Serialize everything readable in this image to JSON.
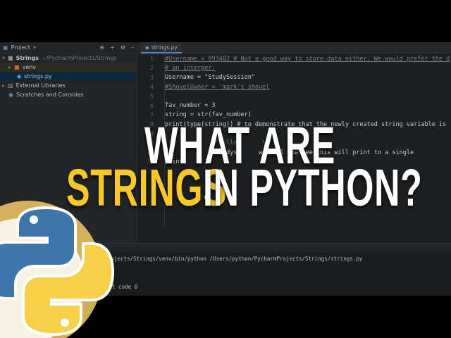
{
  "sidebar": {
    "title": "Project",
    "items": [
      {
        "label": "Strings",
        "extra": "~/PycharmProjects/Strings"
      },
      {
        "label": "venv"
      },
      {
        "label": "strings.py"
      },
      {
        "label": "External Libraries"
      },
      {
        "label": "Scratches and Consoles"
      }
    ]
  },
  "tab": {
    "label": "strings.py"
  },
  "code": [
    {
      "n": "1",
      "text": "#Username = 093482 # Not a good way to store data either. We would prefer the d",
      "cls": "cm"
    },
    {
      "n": "2",
      "text": "# an interger.",
      "cls": "cm"
    },
    {
      "n": "3",
      "text": "Username = \"StudySession\"",
      "cls": "cd"
    },
    {
      "n": "4",
      "text": "#ShovelOwner = 'mark's shovel",
      "cls": "cm"
    },
    {
      "n": "5",
      "text": "",
      "cls": "cd"
    },
    {
      "n": "6",
      "text": "fav_number = 3",
      "cls": "cd"
    },
    {
      "n": "7",
      "text": "string = str(fav_number)",
      "cls": "cd"
    },
    {
      "n": "8",
      "text": "print(type(string)) # to demonstrate that the newly created string variable is",
      "cls": "cd"
    },
    {
      "n": "9",
      "text": "",
      "cls": "cd"
    },
    {
      "n": "10",
      "text": "              \"hello,      \\",
      "cls": "st"
    },
    {
      "n": "11",
      "text": "              studys      we will now see this will print to a single",
      "cls": "cd"
    },
    {
      "n": "12",
      "text": "print(     )",
      "cls": "cd"
    }
  ],
  "run": {
    "line1": "armProjects/Strings/venv/bin/python /Users/python/PycharmProjects/Strings/strings.py",
    "line2": "xit code 0"
  },
  "overlay": {
    "line1": "WHAT ARE",
    "highlight": "STRINGS",
    "line2": "IN PYTHON?",
    "yellow": "#f6c928",
    "white": "#ffffff"
  }
}
